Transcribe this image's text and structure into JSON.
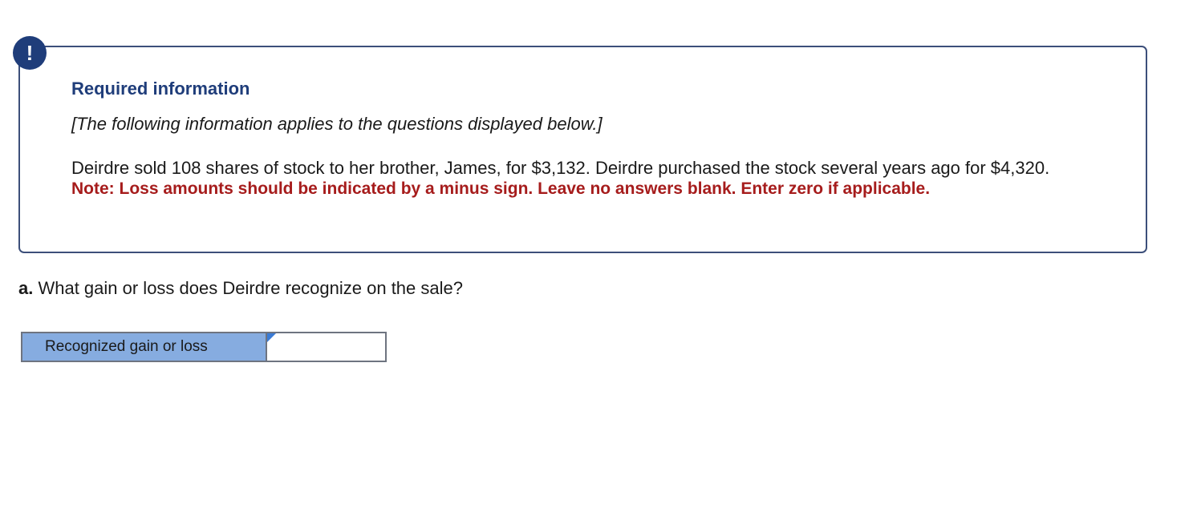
{
  "alert": {
    "icon": "exclamation-icon",
    "symbol": "!",
    "color": "#1f3d7a"
  },
  "info": {
    "title": "Required information",
    "intro": "[The following information applies to the questions displayed below.]",
    "body": "Deirdre sold 108 shares of stock to her brother, James, for $3,132. Deirdre purchased the stock several years ago for $4,320.",
    "note": "Note: Loss amounts should be indicated by a minus sign. Leave no answers blank. Enter zero if applicable.",
    "title_color": "#1f3d7a",
    "note_color": "#a61c1c"
  },
  "question": {
    "label": "a.",
    "text": " What gain or loss does Deirdre recognize on the sale?"
  },
  "answer": {
    "row_label": "Recognized gain or loss",
    "value": "",
    "label_bg_color": "#86ace0"
  }
}
